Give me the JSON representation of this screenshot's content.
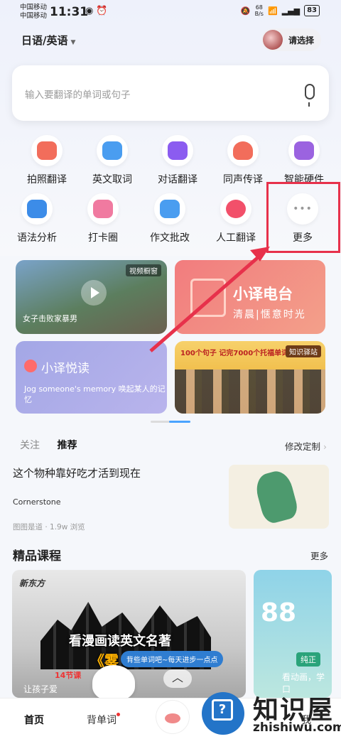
{
  "status": {
    "carrier1": "中国移动",
    "carrier2": "中国移动",
    "time": "11:31",
    "net_speed": "68\nB/s",
    "battery": "83"
  },
  "header": {
    "language": "日语/英语",
    "user_label": "请选择"
  },
  "search": {
    "placeholder": "输入要翻译的单词或句子"
  },
  "features": [
    {
      "label": "拍照翻译",
      "icon": "camera-icon",
      "color": "#f26d5b"
    },
    {
      "label": "英文取词",
      "icon": "add-word-icon",
      "color": "#4a9df0"
    },
    {
      "label": "对话翻译",
      "icon": "chat-icon",
      "color": "#8b5cf0"
    },
    {
      "label": "同声传译",
      "icon": "simultaneous-icon",
      "color": "#f26d5b"
    },
    {
      "label": "智能硬件",
      "icon": "pen-device-icon",
      "color": "#9b63e0"
    },
    {
      "label": "语法分析",
      "icon": "grammar-icon",
      "color": "#3c8ce8"
    },
    {
      "label": "打卡圈",
      "icon": "checkin-icon",
      "color": "#f07aa0"
    },
    {
      "label": "作文批改",
      "icon": "essay-icon",
      "color": "#4a9df0"
    },
    {
      "label": "人工翻译",
      "icon": "human-translate-icon",
      "color": "#f2506a"
    },
    {
      "label": "更多",
      "icon": "more-icon",
      "color": "#bbbbbb"
    }
  ],
  "cards": {
    "video_tag": "视频橱窗",
    "video_caption": "女子击败家暴男",
    "radio_title": "小译电台",
    "radio_sub": "清晨|惬意时光",
    "read_title": "小译悦读",
    "read_text": "Jog someone's memory 唤起某人的记忆",
    "promo_head": "100个句子 记完7000个托福单词",
    "promo_tag": "知识驿站"
  },
  "feed": {
    "tab_follow": "关注",
    "tab_recommend": "推荐",
    "customize": "修改定制",
    "article_title": "这个物种靠好吃才活到现在",
    "article_source": "Cornerstone",
    "article_meta": "图图是道 · 1.9w 浏览"
  },
  "courses": {
    "section_title": "精品课程",
    "more": "更多",
    "brand": "新东方",
    "c1_title": "看漫画读英文名著",
    "c1_title2": "《雾",
    "c1_sub": "14节课",
    "bubble": "背些单词吧~每天进步一点点",
    "c1_foot": "让孩子爱",
    "c2_pill": "纯正",
    "c2_foot": "看动画，学口"
  },
  "nav": {
    "home": "首页",
    "words": "背单词",
    "clipped": "我"
  },
  "watermark": {
    "cn": "知识屋",
    "en": "zhishiwu.com"
  }
}
